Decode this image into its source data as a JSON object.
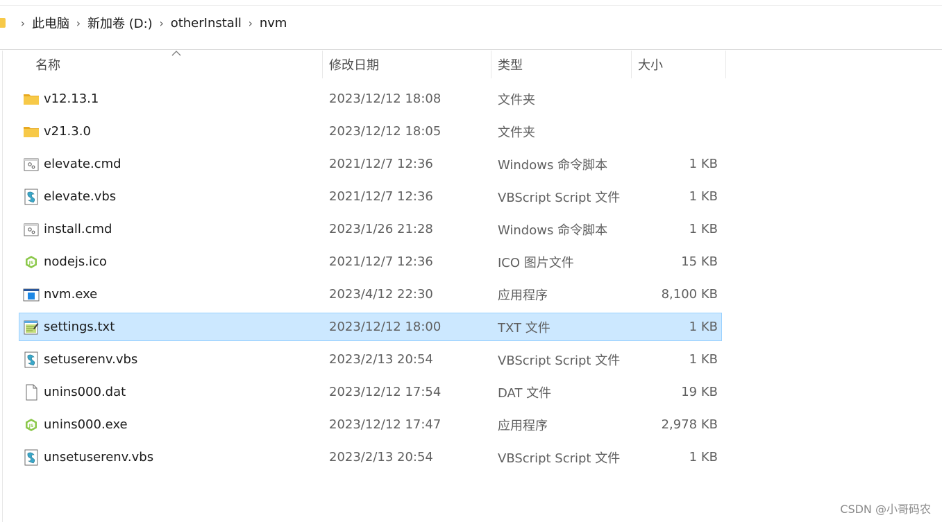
{
  "breadcrumb": [
    "此电脑",
    "新加卷 (D:)",
    "otherInstall",
    "nvm"
  ],
  "columns": {
    "name": "名称",
    "date": "修改日期",
    "type": "类型",
    "size": "大小"
  },
  "files": [
    {
      "name": "v12.13.1",
      "date": "2023/12/12 18:08",
      "type": "文件夹",
      "size": "",
      "icon": "folder-icon",
      "selected": false
    },
    {
      "name": "v21.3.0",
      "date": "2023/12/12 18:05",
      "type": "文件夹",
      "size": "",
      "icon": "folder-icon",
      "selected": false
    },
    {
      "name": "elevate.cmd",
      "date": "2021/12/7 12:36",
      "type": "Windows 命令脚本",
      "size": "1 KB",
      "icon": "cmd-script-icon",
      "selected": false
    },
    {
      "name": "elevate.vbs",
      "date": "2021/12/7 12:36",
      "type": "VBScript Script 文件",
      "size": "1 KB",
      "icon": "vbscript-icon",
      "selected": false
    },
    {
      "name": "install.cmd",
      "date": "2023/1/26 21:28",
      "type": "Windows 命令脚本",
      "size": "1 KB",
      "icon": "cmd-script-icon",
      "selected": false
    },
    {
      "name": "nodejs.ico",
      "date": "2021/12/7 12:36",
      "type": "ICO 图片文件",
      "size": "15 KB",
      "icon": "nodejs-icon",
      "selected": false
    },
    {
      "name": "nvm.exe",
      "date": "2023/4/12 22:30",
      "type": "应用程序",
      "size": "8,100 KB",
      "icon": "exe-window-icon",
      "selected": false
    },
    {
      "name": "settings.txt",
      "date": "2023/12/12 18:00",
      "type": "TXT 文件",
      "size": "1 KB",
      "icon": "notepad-icon",
      "selected": true
    },
    {
      "name": "setuserenv.vbs",
      "date": "2023/2/13 20:54",
      "type": "VBScript Script 文件",
      "size": "1 KB",
      "icon": "vbscript-icon",
      "selected": false
    },
    {
      "name": "unins000.dat",
      "date": "2023/12/12 17:54",
      "type": "DAT 文件",
      "size": "19 KB",
      "icon": "blank-file-icon",
      "selected": false
    },
    {
      "name": "unins000.exe",
      "date": "2023/12/12 17:47",
      "type": "应用程序",
      "size": "2,978 KB",
      "icon": "nodejs-icon",
      "selected": false
    },
    {
      "name": "unsetuserenv.vbs",
      "date": "2023/2/13 20:54",
      "type": "VBScript Script 文件",
      "size": "1 KB",
      "icon": "vbscript-icon",
      "selected": false
    }
  ],
  "watermark": "CSDN @小哥码农",
  "colors": {
    "selection_bg": "#cce8ff",
    "selection_border": "#99d1ff",
    "folder": "#f7c948",
    "nodejs_green": "#8cc84b"
  }
}
